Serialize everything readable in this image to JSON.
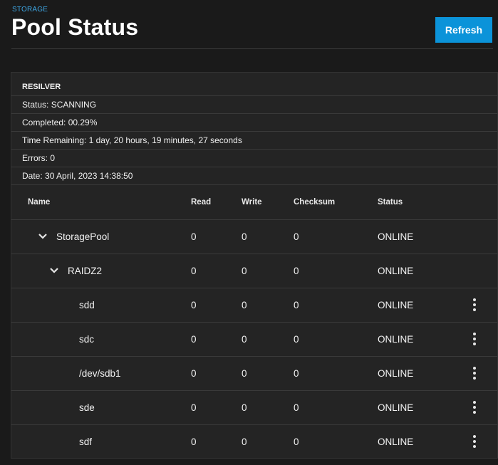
{
  "header": {
    "breadcrumb": "STORAGE",
    "title": "Pool Status",
    "refresh_label": "Refresh"
  },
  "resilver": {
    "title": "RESILVER",
    "status": "Status: SCANNING",
    "completed": "Completed: 00.29%",
    "time_remaining": "Time Remaining: 1 day, 20 hours, 19 minutes, 27 seconds",
    "errors": "Errors: 0",
    "date": "Date: 30 April, 2023 14:38:50"
  },
  "table": {
    "columns": [
      "Name",
      "Read",
      "Write",
      "Checksum",
      "Status"
    ],
    "rows": [
      {
        "name": "StoragePool",
        "read": "0",
        "write": "0",
        "checksum": "0",
        "status": "ONLINE"
      },
      {
        "name": "RAIDZ2",
        "read": "0",
        "write": "0",
        "checksum": "0",
        "status": "ONLINE"
      },
      {
        "name": "sdd",
        "read": "0",
        "write": "0",
        "checksum": "0",
        "status": "ONLINE"
      },
      {
        "name": "sdc",
        "read": "0",
        "write": "0",
        "checksum": "0",
        "status": "ONLINE"
      },
      {
        "name": "/dev/sdb1",
        "read": "0",
        "write": "0",
        "checksum": "0",
        "status": "ONLINE"
      },
      {
        "name": "sde",
        "read": "0",
        "write": "0",
        "checksum": "0",
        "status": "ONLINE"
      },
      {
        "name": "sdf",
        "read": "0",
        "write": "0",
        "checksum": "0",
        "status": "ONLINE"
      }
    ]
  },
  "icons": {
    "expand": "chevron-down-icon",
    "actions": "more-vert-icon"
  },
  "colors": {
    "accent": "#0b93d9",
    "breadcrumb": "#3ea8e6",
    "background": "#1a1a1a",
    "card": "#242424"
  }
}
